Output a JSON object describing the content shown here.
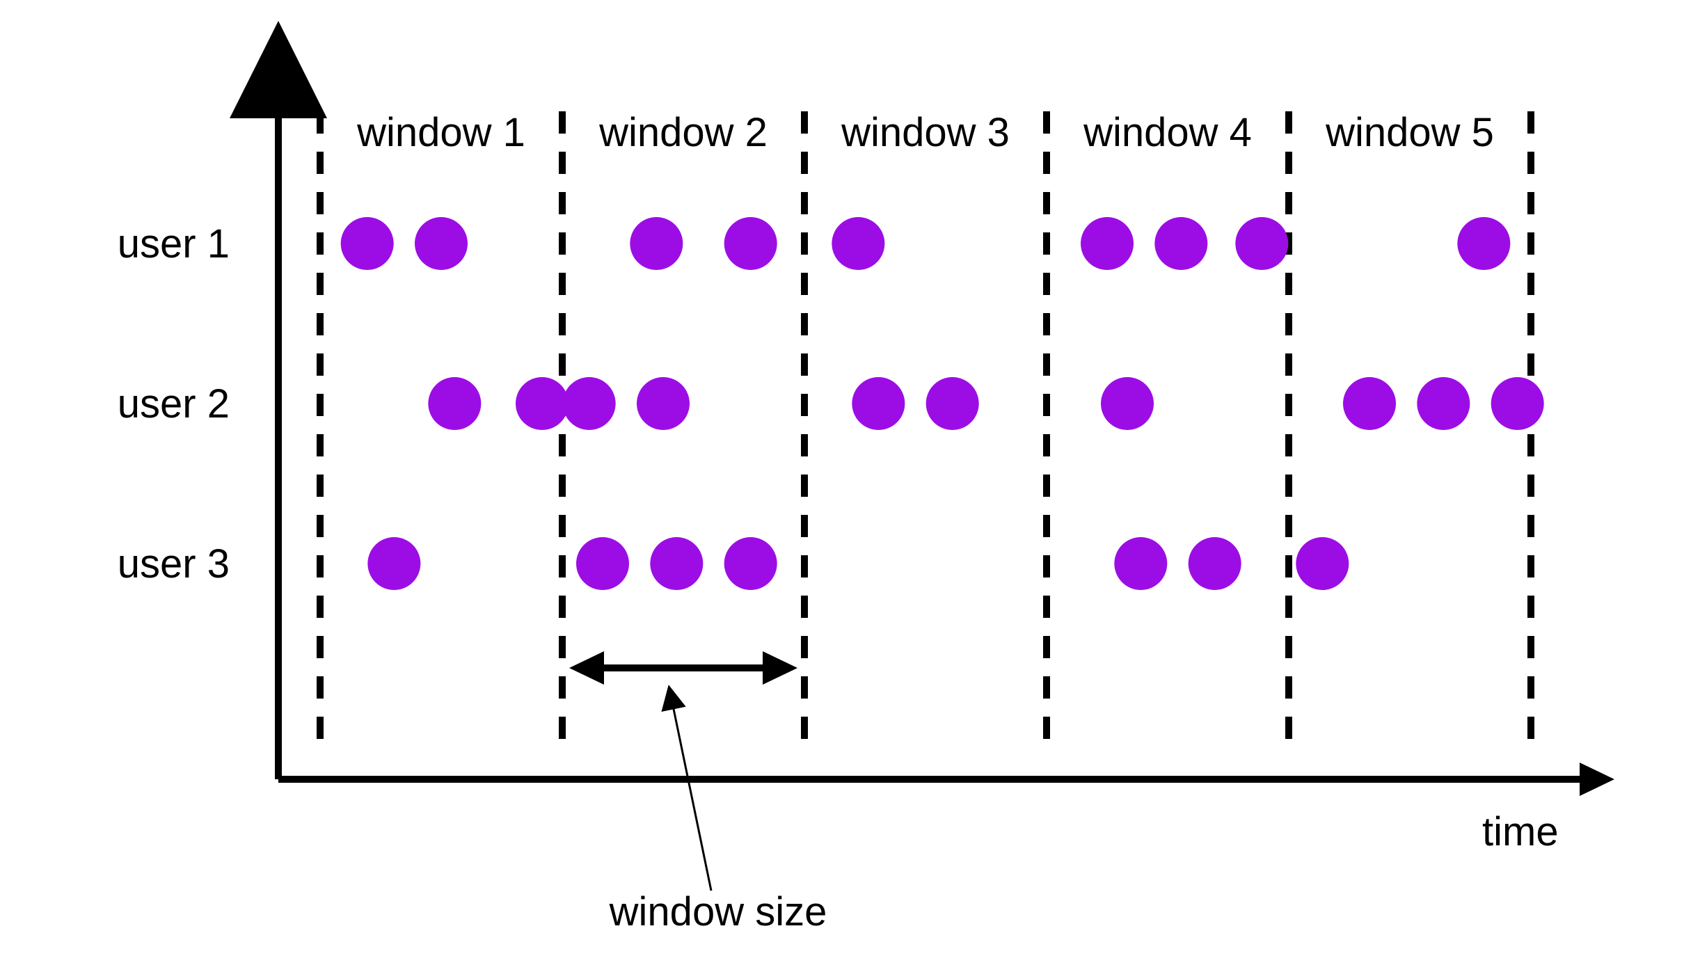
{
  "chart_data": {
    "type": "scatter",
    "title": "",
    "xlabel": "time",
    "ylabel": "",
    "window_size_label": "window size",
    "windows": [
      {
        "id": 1,
        "label": "window 1",
        "start": 0,
        "end": 360
      },
      {
        "id": 2,
        "label": "window 2",
        "start": 360,
        "end": 720
      },
      {
        "id": 3,
        "label": "window 3",
        "start": 720,
        "end": 1080
      },
      {
        "id": 4,
        "label": "window 4",
        "start": 1080,
        "end": 1440
      },
      {
        "id": 5,
        "label": "window 5",
        "start": 1440,
        "end": 1800
      }
    ],
    "users": [
      {
        "name": "user 1",
        "events_t": [
          70,
          180,
          500,
          640,
          800,
          1170,
          1280,
          1400,
          1730
        ]
      },
      {
        "name": "user 2",
        "events_t": [
          200,
          330,
          400,
          510,
          830,
          940,
          1200,
          1560,
          1670,
          1780
        ]
      },
      {
        "name": "user 3",
        "events_t": [
          110,
          420,
          530,
          640,
          1220,
          1330,
          1490
        ]
      }
    ],
    "window_size_indicator": {
      "from_window": 2,
      "to_window": 2
    },
    "dot_color": "#9c0de6",
    "axis_color": "#000000"
  }
}
